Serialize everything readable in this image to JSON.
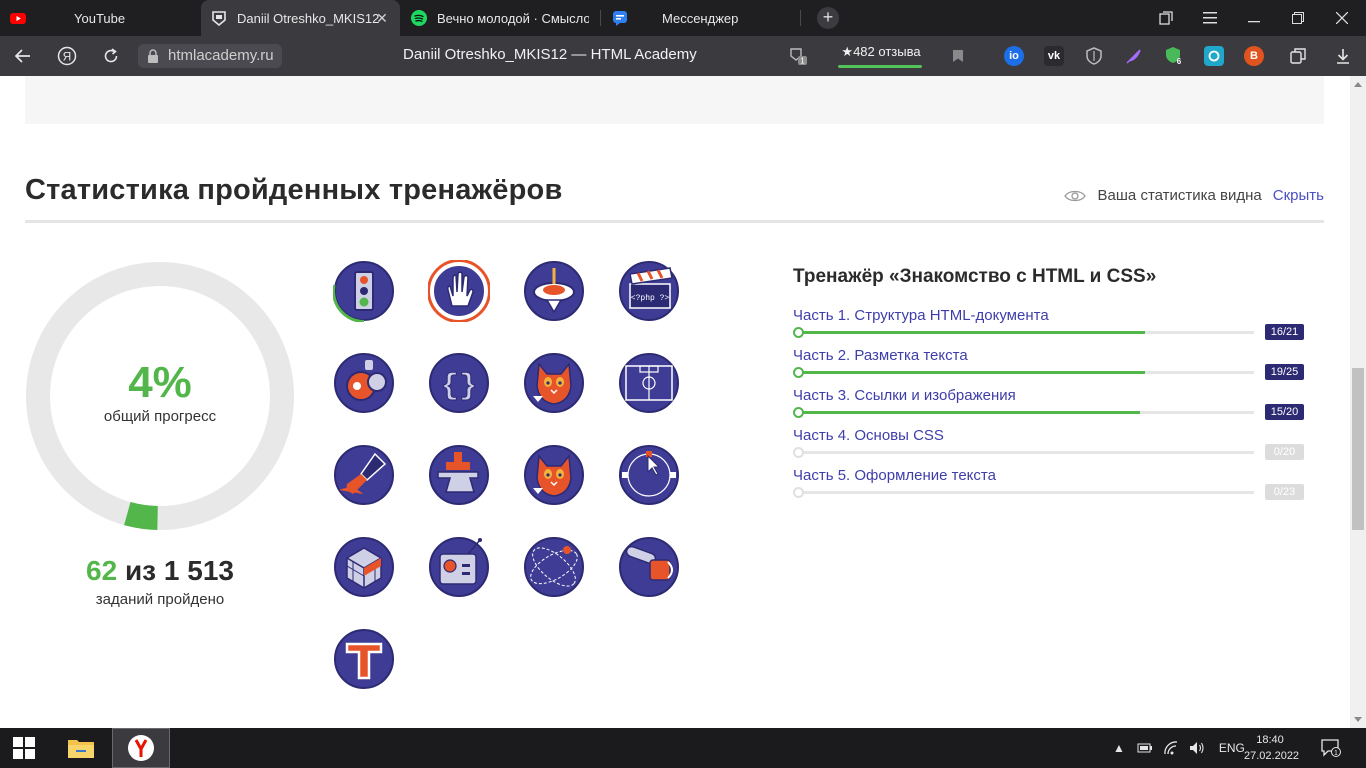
{
  "tabs": [
    {
      "label": "YouTube",
      "icon": "youtube-icon"
    },
    {
      "label": "Daniil Otreshko_MKIS12",
      "icon": "htmlacademy-icon",
      "active": true
    },
    {
      "label": "Вечно молодой · Смыслов",
      "icon": "spotify-icon"
    },
    {
      "label": "Мессенджер",
      "icon": "messenger-icon"
    }
  ],
  "address": {
    "url": "htmlacademy.ru",
    "page_title": "Daniil Otreshko_MKIS12 — HTML Academy",
    "reviews_label": "★482 отзыва",
    "extension_badge_shield": "6",
    "downloads_badge": "1"
  },
  "section": {
    "title": "Статистика пройденных тренажёров",
    "visibility_text": "Ваша статистика видна",
    "hide_link": "Скрыть"
  },
  "progress": {
    "percent_label": "4%",
    "percent_value": 4,
    "percent_caption": "общий прогресс",
    "done": "62",
    "of_word": "из",
    "total": "1 513",
    "count_caption": "заданий пройдено"
  },
  "badges": [
    {
      "name": "traffic-light-badge",
      "progress": 0.28
    },
    {
      "name": "hand-badge",
      "progress": 1.0
    },
    {
      "name": "spinning-top-badge",
      "progress": 0
    },
    {
      "name": "clapperboard-badge",
      "progress": 0
    },
    {
      "name": "diving-helmet-badge",
      "progress": 0
    },
    {
      "name": "curly-braces-badge",
      "progress": 0
    },
    {
      "name": "cat-badge",
      "progress": 0
    },
    {
      "name": "football-field-badge",
      "progress": 0
    },
    {
      "name": "paint-brush-badge",
      "progress": 0
    },
    {
      "name": "anvil-badge",
      "progress": 0
    },
    {
      "name": "cat-drink-badge",
      "progress": 0
    },
    {
      "name": "vector-cursor-badge",
      "progress": 0
    },
    {
      "name": "rubik-cube-badge",
      "progress": 0
    },
    {
      "name": "remote-control-badge",
      "progress": 0
    },
    {
      "name": "orbit-badge",
      "progress": 0
    },
    {
      "name": "chainsaw-badge",
      "progress": 0
    },
    {
      "name": "typography-badge",
      "progress": 0
    }
  ],
  "course": {
    "title": "Тренажёр «Знакомство с HTML и CSS»",
    "parts": [
      {
        "label": "Часть 1. Структура HTML-документа",
        "done": 16,
        "total": 21,
        "score": "16/21"
      },
      {
        "label": "Часть 2. Разметка текста",
        "done": 19,
        "total": 25,
        "score": "19/25"
      },
      {
        "label": "Часть 3. Ссылки и изображения",
        "done": 15,
        "total": 20,
        "score": "15/20"
      },
      {
        "label": "Часть 4. Основы CSS",
        "done": 0,
        "total": 20,
        "score": "0/20"
      },
      {
        "label": "Часть 5. Оформление текста",
        "done": 0,
        "total": 23,
        "score": "0/23"
      }
    ]
  },
  "taskbar": {
    "language": "ENG",
    "time": "18:40",
    "date": "27.02.2022",
    "notifications": "1"
  },
  "colors": {
    "accent_green": "#52b64a",
    "link_purple": "#3e3eaa",
    "badge_navy": "#2d2a74",
    "badge_fill": "#3f3c95",
    "badge_orange": "#e8542a"
  }
}
